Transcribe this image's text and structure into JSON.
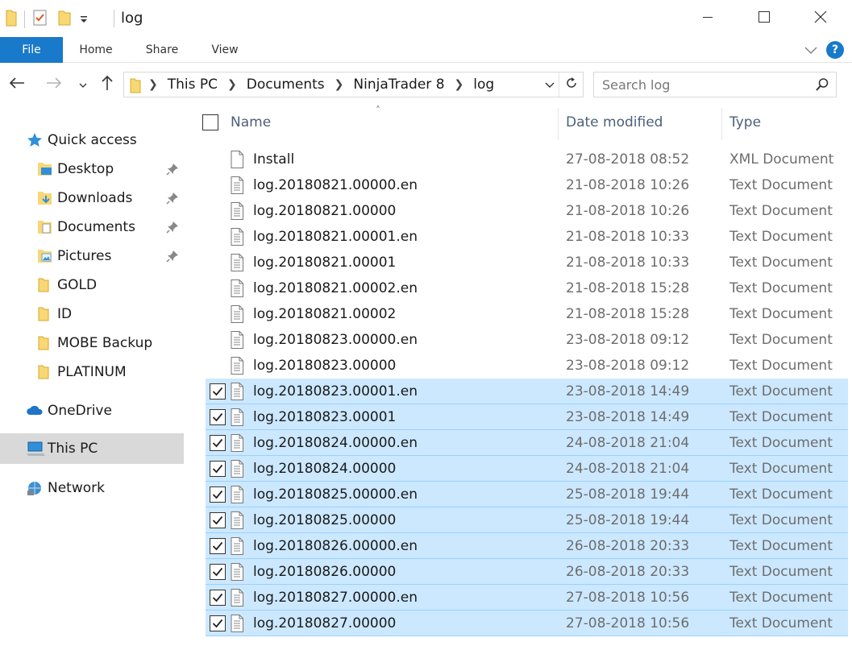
{
  "window": {
    "title": "log",
    "minimize_icon": "minimize-icon",
    "maximize_icon": "maximize-icon",
    "close_icon": "close-icon"
  },
  "ribbon": {
    "tabs": [
      "File",
      "Home",
      "Share",
      "View"
    ],
    "help_label": "?"
  },
  "address": {
    "crumbs": [
      "This PC",
      "Documents",
      "NinjaTrader 8",
      "log"
    ]
  },
  "search": {
    "placeholder": "Search log"
  },
  "sidebar": {
    "items": [
      {
        "label": "Quick access",
        "icon": "star-icon",
        "pinned": false
      },
      {
        "label": "Desktop",
        "icon": "desktop-folder-icon",
        "pinned": true
      },
      {
        "label": "Downloads",
        "icon": "downloads-folder-icon",
        "pinned": true
      },
      {
        "label": "Documents",
        "icon": "documents-folder-icon",
        "pinned": true
      },
      {
        "label": "Pictures",
        "icon": "pictures-folder-icon",
        "pinned": true
      },
      {
        "label": "GOLD",
        "icon": "folder-icon",
        "pinned": false
      },
      {
        "label": "ID",
        "icon": "folder-icon",
        "pinned": false
      },
      {
        "label": "MOBE Backup",
        "icon": "folder-icon",
        "pinned": false
      },
      {
        "label": "PLATINUM",
        "icon": "folder-icon",
        "pinned": false
      },
      {
        "label": "OneDrive",
        "icon": "cloud-icon",
        "pinned": false
      },
      {
        "label": "This PC",
        "icon": "computer-icon",
        "pinned": false,
        "selected": true
      },
      {
        "label": "Network",
        "icon": "network-icon",
        "pinned": false
      }
    ]
  },
  "columns": {
    "name": "Name",
    "date": "Date modified",
    "type": "Type"
  },
  "files": [
    {
      "name": "Install",
      "date": "27-08-2018 08:52",
      "type": "XML Document",
      "selected": false,
      "icon": "blank-file-icon"
    },
    {
      "name": "log.20180821.00000.en",
      "date": "21-08-2018 10:26",
      "type": "Text Document",
      "selected": false,
      "icon": "text-file-icon"
    },
    {
      "name": "log.20180821.00000",
      "date": "21-08-2018 10:26",
      "type": "Text Document",
      "selected": false,
      "icon": "text-file-icon"
    },
    {
      "name": "log.20180821.00001.en",
      "date": "21-08-2018 10:33",
      "type": "Text Document",
      "selected": false,
      "icon": "text-file-icon"
    },
    {
      "name": "log.20180821.00001",
      "date": "21-08-2018 10:33",
      "type": "Text Document",
      "selected": false,
      "icon": "text-file-icon"
    },
    {
      "name": "log.20180821.00002.en",
      "date": "21-08-2018 15:28",
      "type": "Text Document",
      "selected": false,
      "icon": "text-file-icon"
    },
    {
      "name": "log.20180821.00002",
      "date": "21-08-2018 15:28",
      "type": "Text Document",
      "selected": false,
      "icon": "text-file-icon"
    },
    {
      "name": "log.20180823.00000.en",
      "date": "23-08-2018 09:12",
      "type": "Text Document",
      "selected": false,
      "icon": "text-file-icon"
    },
    {
      "name": "log.20180823.00000",
      "date": "23-08-2018 09:12",
      "type": "Text Document",
      "selected": false,
      "icon": "text-file-icon"
    },
    {
      "name": "log.20180823.00001.en",
      "date": "23-08-2018 14:49",
      "type": "Text Document",
      "selected": true,
      "icon": "text-file-icon"
    },
    {
      "name": "log.20180823.00001",
      "date": "23-08-2018 14:49",
      "type": "Text Document",
      "selected": true,
      "icon": "text-file-icon"
    },
    {
      "name": "log.20180824.00000.en",
      "date": "24-08-2018 21:04",
      "type": "Text Document",
      "selected": true,
      "icon": "text-file-icon"
    },
    {
      "name": "log.20180824.00000",
      "date": "24-08-2018 21:04",
      "type": "Text Document",
      "selected": true,
      "icon": "text-file-icon"
    },
    {
      "name": "log.20180825.00000.en",
      "date": "25-08-2018 19:44",
      "type": "Text Document",
      "selected": true,
      "icon": "text-file-icon"
    },
    {
      "name": "log.20180825.00000",
      "date": "25-08-2018 19:44",
      "type": "Text Document",
      "selected": true,
      "icon": "text-file-icon"
    },
    {
      "name": "log.20180826.00000.en",
      "date": "26-08-2018 20:33",
      "type": "Text Document",
      "selected": true,
      "icon": "text-file-icon"
    },
    {
      "name": "log.20180826.00000",
      "date": "26-08-2018 20:33",
      "type": "Text Document",
      "selected": true,
      "icon": "text-file-icon"
    },
    {
      "name": "log.20180827.00000.en",
      "date": "27-08-2018 10:56",
      "type": "Text Document",
      "selected": true,
      "icon": "text-file-icon"
    },
    {
      "name": "log.20180827.00000",
      "date": "27-08-2018 10:56",
      "type": "Text Document",
      "selected": true,
      "icon": "text-file-icon"
    }
  ],
  "colors": {
    "accent": "#1979ca",
    "selection_bg": "#cce8ff",
    "selection_border": "#99d1ff",
    "folder": "#f8d775",
    "nav_selected": "#d9d9d9",
    "header_text": "#4c607a"
  }
}
